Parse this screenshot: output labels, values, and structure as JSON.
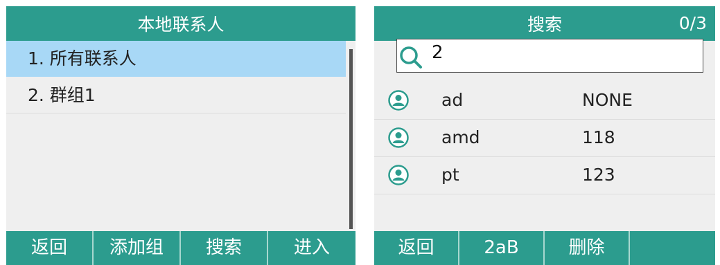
{
  "left_screen": {
    "title": "本地联系人",
    "items": [
      {
        "label": "1. 所有联系人",
        "selected": true
      },
      {
        "label": "2. 群组1",
        "selected": false
      }
    ],
    "softkeys": [
      "返回",
      "添加组",
      "搜索",
      "进入"
    ]
  },
  "right_screen": {
    "title": "搜索",
    "count": "0/3",
    "search": {
      "value": "2",
      "icon": "search-icon"
    },
    "contacts": [
      {
        "name": "ad",
        "number": "NONE",
        "icon": "contact-icon"
      },
      {
        "name": "amd",
        "number": "118",
        "icon": "contact-icon"
      },
      {
        "name": "pt",
        "number": "123",
        "icon": "contact-icon"
      }
    ],
    "softkeys": [
      "返回",
      "2aB",
      "删除",
      ""
    ]
  },
  "colors": {
    "title_bar": "#2c9c8e",
    "selected_row": "#a8d8f6",
    "screen_bg": "#efefef",
    "contact_icon": "#2c9c8e"
  }
}
